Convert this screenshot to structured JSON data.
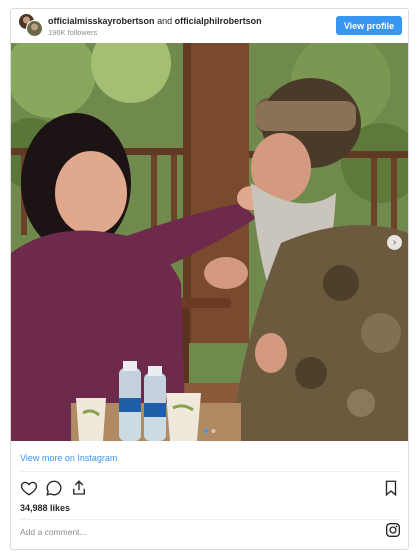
{
  "header": {
    "user1": "officialmisskayrobertson",
    "conjunction": "and",
    "user2": "officialphilrobertson",
    "followers": "196K followers",
    "view_profile": "View profile"
  },
  "photo": {
    "carousel_count": 2,
    "active_index": 0
  },
  "links": {
    "view_more": "View more on Instagram"
  },
  "actions": {
    "icons": [
      "heart-icon",
      "comment-icon",
      "share-icon",
      "bookmark-icon"
    ]
  },
  "stats": {
    "likes": "34,988 likes"
  },
  "comment": {
    "placeholder": "Add a comment..."
  },
  "colors": {
    "accent": "#3897f0",
    "border": "#dbdbdb",
    "muted": "#8e8e8e"
  }
}
